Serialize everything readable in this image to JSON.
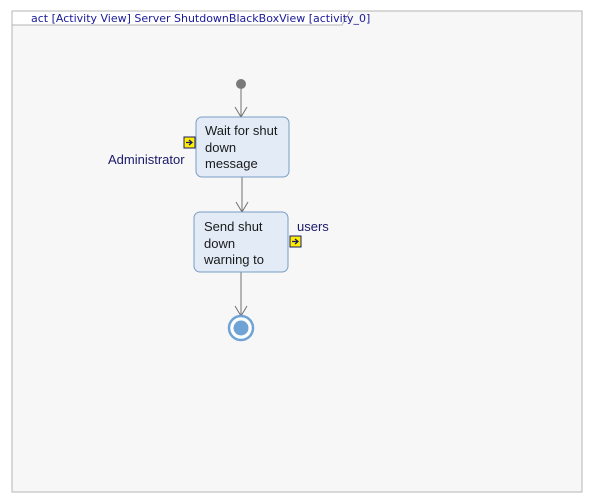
{
  "frame": {
    "title": "act [Activity View] Server ShutdownBlackBoxView [activity_0]"
  },
  "actions": [
    {
      "id": "wait",
      "lines": [
        "Wait for shut",
        "down",
        "message"
      ]
    },
    {
      "id": "send",
      "lines": [
        "Send shut",
        "down",
        "warning to"
      ]
    }
  ],
  "pins": [
    {
      "label": "Administrator",
      "action": "wait"
    },
    {
      "label": "users",
      "action": "send"
    }
  ],
  "colors": {
    "frame_border": "#b5b5b5",
    "frame_bg": "#f7f7f7",
    "action_fill": "#e3ecf6",
    "action_border": "#7a9cc4",
    "pin_fill": "#ffee00",
    "pin_border": "#1a1a6a",
    "initial_node": "#7a7a7a",
    "final_node": "#6fa3d6",
    "flow": "#707070"
  }
}
